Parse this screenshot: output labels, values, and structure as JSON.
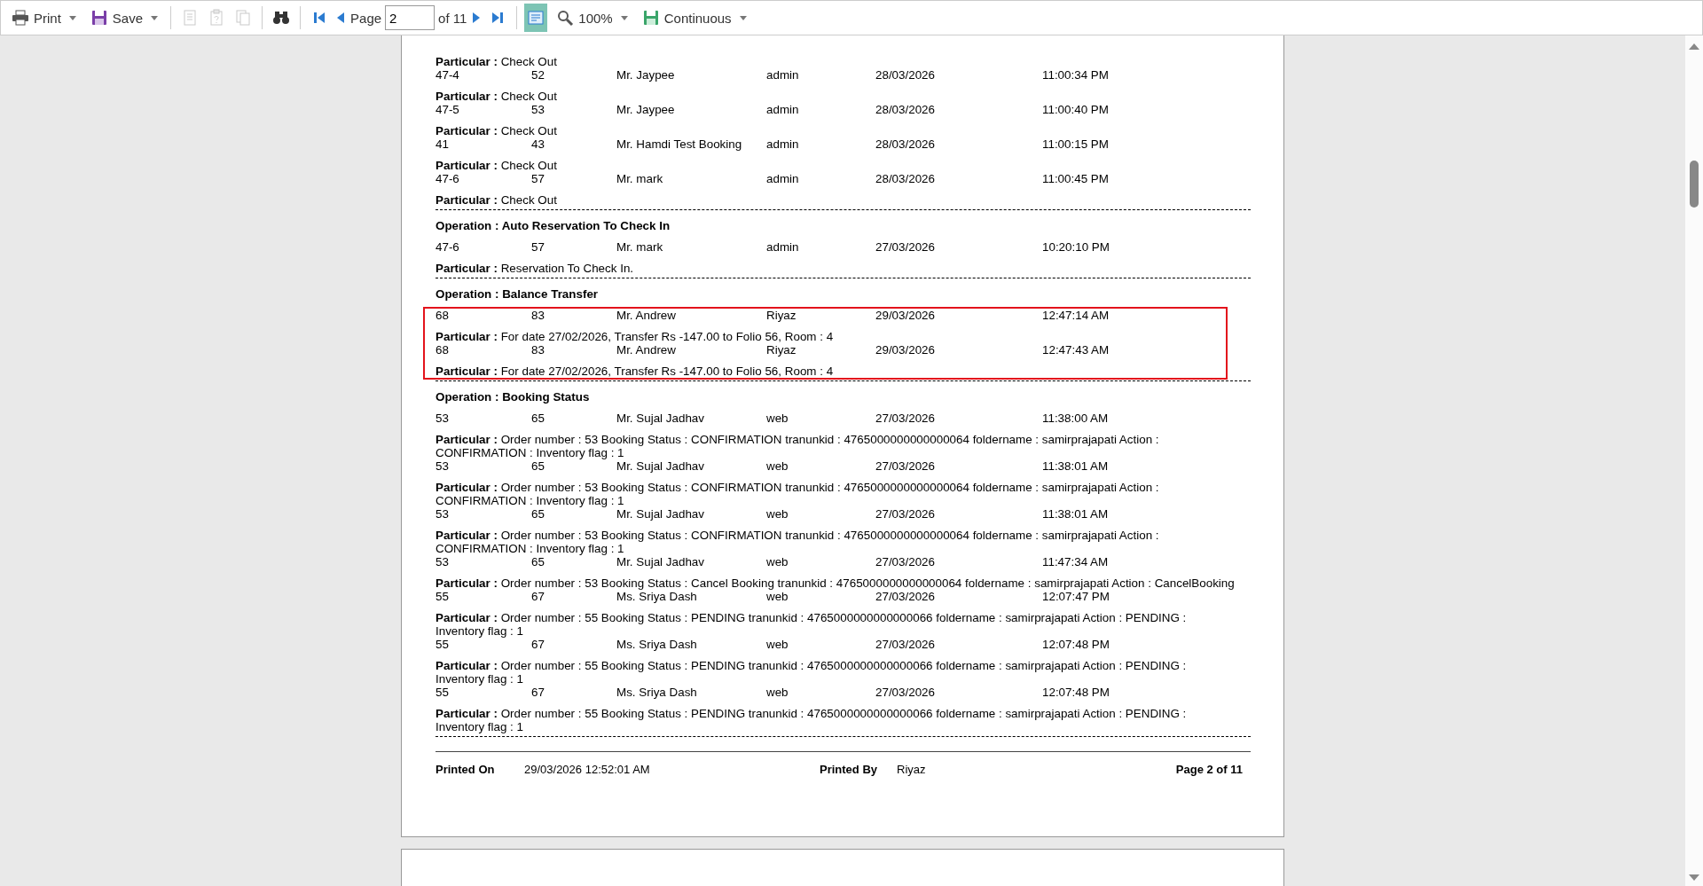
{
  "toolbar": {
    "print": "Print",
    "save": "Save",
    "edit_tools": [
      {
        "disabled": true
      },
      {
        "disabled": true
      },
      {
        "disabled": true
      }
    ],
    "page_label": "Page",
    "page_value": "2",
    "page_total": "of 11",
    "page_view": {
      "on": true
    },
    "zoom": "100%",
    "view_mode": "Continuous"
  },
  "report": {
    "groups": [
      {
        "highlighted": false,
        "lines": [
          {
            "kind": "particular",
            "text": "**Particular :** Check Out"
          },
          {
            "kind": "row",
            "cells": [
              "47-4",
              "52",
              "Mr. Jaypee",
              "admin",
              "28/03/2026",
              "11:00:34 PM"
            ]
          },
          {
            "kind": "particular",
            "text": "**Particular :** Check Out"
          },
          {
            "kind": "row",
            "cells": [
              "47-5",
              "53",
              "Mr. Jaypee",
              "admin",
              "28/03/2026",
              "11:00:40 PM"
            ]
          },
          {
            "kind": "particular",
            "text": "**Particular :** Check Out"
          },
          {
            "kind": "row",
            "cells": [
              "41",
              "43",
              "Mr. Hamdi Test Booking",
              "admin",
              "28/03/2026",
              "11:00:15 PM"
            ]
          },
          {
            "kind": "particular",
            "text": "**Particular :** Check Out"
          },
          {
            "kind": "row",
            "cells": [
              "47-6",
              "57",
              "Mr. mark",
              "admin",
              "28/03/2026",
              "11:00:45 PM"
            ]
          },
          {
            "kind": "particular",
            "text": "**Particular :** Check Out"
          }
        ]
      },
      {
        "operation": "Operation : Auto Reservation To Check In",
        "highlighted": false,
        "lines": [
          {
            "kind": "row",
            "cells": [
              "47-6",
              "57",
              "Mr. mark",
              "admin",
              "27/03/2026",
              "10:20:10 PM"
            ]
          },
          {
            "kind": "particular",
            "text": "**Particular :** Reservation To Check In."
          }
        ]
      },
      {
        "operation": "Operation : Balance Transfer",
        "highlighted": true,
        "lines": [
          {
            "kind": "row",
            "cells": [
              "68",
              "83",
              "Mr. Andrew",
              "Riyaz",
              "29/03/2026",
              "12:47:14 AM"
            ]
          },
          {
            "kind": "particular",
            "text": "**Particular :** For date 27/02/2026, Transfer Rs -147.00 to Folio 56, Room : 4"
          },
          {
            "kind": "row",
            "cells": [
              "68",
              "83",
              "Mr. Andrew",
              "Riyaz",
              "29/03/2026",
              "12:47:43 AM"
            ]
          },
          {
            "kind": "particular",
            "text": "**Particular :** For date 27/02/2026, Transfer Rs -147.00 to Folio 56, Room : 4"
          }
        ]
      },
      {
        "operation": "Operation : Booking Status",
        "highlighted": false,
        "lines": [
          {
            "kind": "row",
            "cells": [
              "53",
              "65",
              "Mr. Sujal Jadhav",
              "web",
              "27/03/2026",
              "11:38:00 AM"
            ]
          },
          {
            "kind": "particular",
            "text": "**Particular :** Order number : 53 Booking Status : CONFIRMATION tranunkid : 4765000000000000064 foldername : samirprajapati Action : CONFIRMATION : Inventory flag : 1"
          },
          {
            "kind": "row",
            "cells": [
              "53",
              "65",
              "Mr. Sujal Jadhav",
              "web",
              "27/03/2026",
              "11:38:01 AM"
            ]
          },
          {
            "kind": "particular",
            "text": "**Particular :** Order number : 53 Booking Status : CONFIRMATION tranunkid : 4765000000000000064 foldername : samirprajapati Action : CONFIRMATION : Inventory flag : 1"
          },
          {
            "kind": "row",
            "cells": [
              "53",
              "65",
              "Mr. Sujal Jadhav",
              "web",
              "27/03/2026",
              "11:38:01 AM"
            ]
          },
          {
            "kind": "particular",
            "text": "**Particular :** Order number : 53 Booking Status : CONFIRMATION tranunkid : 4765000000000000064 foldername : samirprajapati Action : CONFIRMATION : Inventory flag : 1"
          },
          {
            "kind": "row",
            "cells": [
              "53",
              "65",
              "Mr. Sujal Jadhav",
              "web",
              "27/03/2026",
              "11:47:34 AM"
            ]
          },
          {
            "kind": "particular",
            "text": "**Particular :** Order number : 53 Booking Status : Cancel Booking tranunkid : 4765000000000000064 foldername : samirprajapati Action : CancelBooking"
          },
          {
            "kind": "row",
            "cells": [
              "55",
              "67",
              "Ms. Sriya Dash",
              "web",
              "27/03/2026",
              "12:07:47 PM"
            ]
          },
          {
            "kind": "particular",
            "text": "**Particular :** Order number : 55 Booking Status : PENDING tranunkid : 4765000000000000066 foldername : samirprajapati Action : PENDING : Inventory flag : 1"
          },
          {
            "kind": "row",
            "cells": [
              "55",
              "67",
              "Ms. Sriya Dash",
              "web",
              "27/03/2026",
              "12:07:48 PM"
            ]
          },
          {
            "kind": "particular",
            "text": "**Particular :** Order number : 55 Booking Status : PENDING tranunkid : 4765000000000000066 foldername : samirprajapati Action : PENDING : Inventory flag : 1"
          },
          {
            "kind": "row",
            "cells": [
              "55",
              "67",
              "Ms. Sriya Dash",
              "web",
              "27/03/2026",
              "12:07:48 PM"
            ]
          },
          {
            "kind": "particular",
            "text": "**Particular :** Order number : 55 Booking Status : PENDING tranunkid : 4765000000000000066 foldername : samirprajapati Action : PENDING : Inventory flag : 1"
          }
        ]
      }
    ]
  },
  "footer": {
    "printed_on_label": "Printed On",
    "printed_on": "29/03/2026 12:52:01 AM",
    "printed_by_label": "Printed By",
    "printed_by": "Riyaz",
    "page": "Page 2 of 11"
  }
}
